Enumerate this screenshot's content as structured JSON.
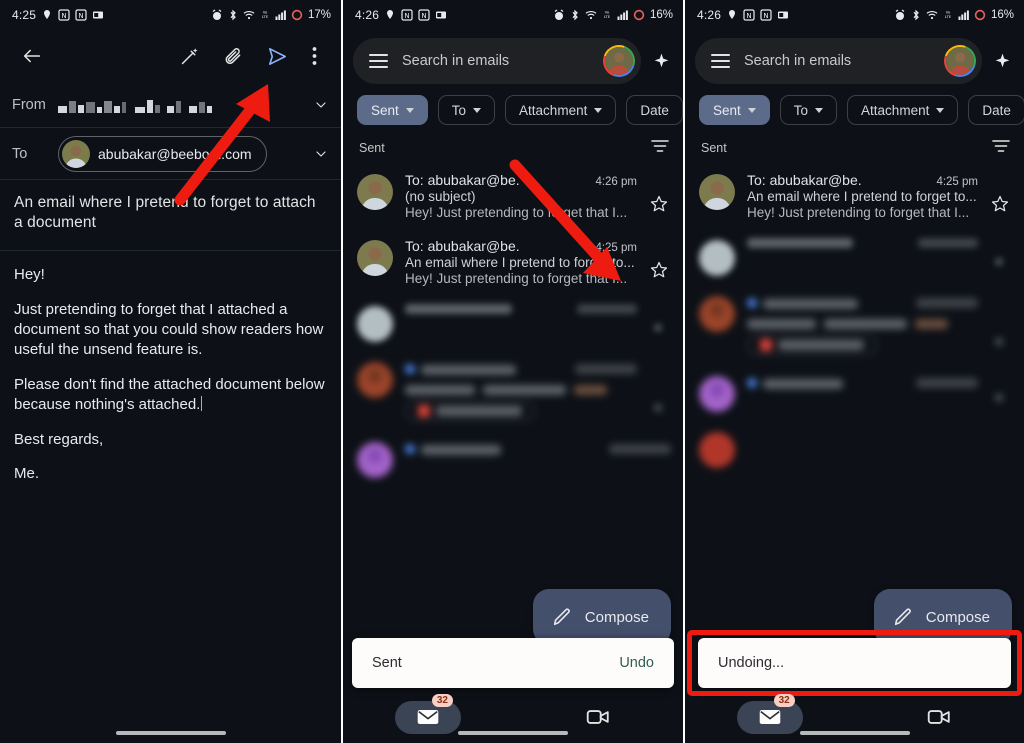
{
  "panels": [
    {
      "id": "compose",
      "status": {
        "time": "4:25",
        "battery": "17%",
        "left_icons": [
          "location-icon",
          "notion-icon",
          "notion-icon",
          "news-icon"
        ],
        "right_icons": [
          "alarm-icon",
          "bluetooth-icon",
          "wifi-icon",
          "volte-icon",
          "signal-icon",
          "battery-ring-icon"
        ]
      },
      "toolbar": {
        "back_label": "",
        "actions": [
          "magic-compose-icon",
          "attach-icon",
          "send-icon",
          "more-icon"
        ]
      },
      "fields": {
        "from_label": "From",
        "from_value": "",
        "to_label": "To",
        "to_value": "abubakar@beebom.com"
      },
      "subject": "An email where I pretend to forget to attach a document",
      "body": [
        "Hey!",
        "Just pretending to forget that I attached a document so that you could show readers how useful the unsend feature is.",
        "Please don't find the attached document below because nothing's attached.",
        "Best regards,",
        "Me."
      ]
    },
    {
      "id": "sent-list-undo",
      "status": {
        "time": "4:26",
        "battery": "16%"
      },
      "search": {
        "placeholder": "Search in emails"
      },
      "chips": [
        {
          "label": "Sent",
          "active": true,
          "dropdown": true
        },
        {
          "label": "To",
          "active": false,
          "dropdown": true
        },
        {
          "label": "Attachment",
          "active": false,
          "dropdown": true
        },
        {
          "label": "Date",
          "active": false,
          "dropdown": false
        }
      ],
      "section_label": "Sent",
      "mails": [
        {
          "to": "To: abubakar@be.",
          "time": "4:26 pm",
          "subject": "(no subject)",
          "snippet": "Hey! Just pretending to forget that I..."
        },
        {
          "to": "To: abubakar@be.",
          "time": "4:25 pm",
          "subject": "An email where I pretend to forget to...",
          "snippet": "Hey! Just pretending to forget that I..."
        }
      ],
      "fab": {
        "label": "Compose"
      },
      "snackbar": {
        "text": "Sent",
        "action": "Undo",
        "highlighted": false
      },
      "bottom_nav": {
        "mail_badge": "32",
        "items": [
          "mail-icon",
          "meet-icon"
        ]
      },
      "partial_text": {
        "attachment_1": "Trips_Flight",
        "attachment_2": "Visa Invitati",
        "number": "09842066"
      }
    },
    {
      "id": "sent-list-undoing",
      "status": {
        "time": "4:26",
        "battery": "16%"
      },
      "search": {
        "placeholder": "Search in emails"
      },
      "chips": [
        {
          "label": "Sent",
          "active": true,
          "dropdown": true
        },
        {
          "label": "To",
          "active": false,
          "dropdown": true
        },
        {
          "label": "Attachment",
          "active": false,
          "dropdown": true
        },
        {
          "label": "Date",
          "active": false,
          "dropdown": false
        }
      ],
      "section_label": "Sent",
      "mails": [
        {
          "to": "To: abubakar@be.",
          "time": "4:25 pm",
          "subject": "An email where I pretend to forget to...",
          "snippet": "Hey! Just pretending to forget that I..."
        }
      ],
      "fab": {
        "label": "Compose"
      },
      "snackbar": {
        "text": "Undoing...",
        "action": "",
        "highlighted": true
      },
      "bottom_nav": {
        "mail_badge": "32",
        "items": [
          "mail-icon",
          "meet-icon"
        ]
      }
    }
  ],
  "annotations": {
    "arrow_1_target": "send-icon",
    "arrow_2_target": "undo-button",
    "highlight_box_target": "undoing-snackbar",
    "color": "#ee1c10"
  },
  "colors": {
    "background": "#0d1117",
    "chip_active": "#5c6b8a",
    "fab": "#434f6b",
    "snackbar_bg": "#fdfcfb",
    "undo_text": "#2f5f52",
    "accent_red": "#ee1c10",
    "badge_bg": "#f7cfc5"
  }
}
